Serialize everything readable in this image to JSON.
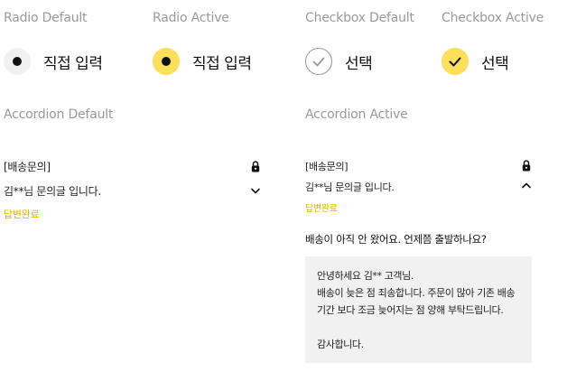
{
  "captions": {
    "radio_default": "Radio Default",
    "radio_active": "Radio Active",
    "checkbox_default": "Checkbox Default",
    "checkbox_active": "Checkbox Active",
    "accordion_default": "Accordion Default",
    "accordion_active": "Accordion Active"
  },
  "controls": {
    "radio_default_label": "직접 입력",
    "radio_active_label": "직접 입력",
    "checkbox_default_label": "선택",
    "checkbox_active_label": "선택"
  },
  "accordion_default": {
    "category": "[배송문의]",
    "question_title": "김**님 문의글 입니다.",
    "status": "답변완료",
    "lock_icon": "lock-icon",
    "toggle_icon": "chevron-down-icon"
  },
  "accordion_active": {
    "category": "[배송문의]",
    "question_title": "김**님 문의글 입니다.",
    "status": "답변완료",
    "lock_icon": "lock-icon",
    "toggle_icon": "chevron-up-icon",
    "question_body": "배송이 아직 안 왔어요. 언제쯤 출발하나요?",
    "answer_lines": [
      "안녕하세요 김** 고객님.",
      "배송이 늦은 점 죄송합니다. 주문이 많아 기존 배송",
      "기간 보다 조금 늦어지는 점 양해 부탁드립니다.",
      "",
      "감사합니다."
    ]
  },
  "colors": {
    "accent": "#ffde59",
    "status": "#e3b200",
    "caption": "#9a9a9a",
    "answer_bg": "#f1f1f1"
  }
}
